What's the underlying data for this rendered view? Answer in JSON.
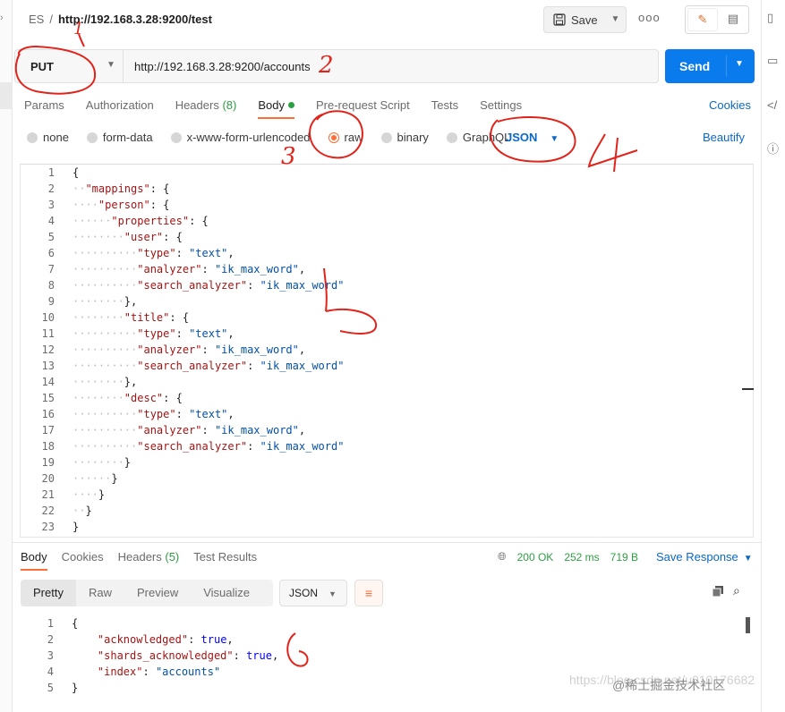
{
  "header": {
    "collection": "ES",
    "separator": "/",
    "request_name": "http://192.168.3.28:9200/test",
    "save_label": "Save",
    "more_label": "ooo"
  },
  "urlbar": {
    "method": "PUT",
    "url": "http://192.168.3.28:9200/accounts",
    "send_label": "Send"
  },
  "request_tabs": [
    {
      "label": "Params"
    },
    {
      "label": "Authorization"
    },
    {
      "label": "Headers",
      "count": "(8)"
    },
    {
      "label": "Body"
    },
    {
      "label": "Pre-request Script"
    },
    {
      "label": "Tests"
    },
    {
      "label": "Settings"
    }
  ],
  "cookies_label": "Cookies",
  "body_types": [
    "none",
    "form-data",
    "x-www-form-urlencoded",
    "raw",
    "binary",
    "GraphQL"
  ],
  "body_format": "JSON",
  "beautify_label": "Beautify",
  "request_body": [
    {
      "n": "1",
      "indent": "",
      "t": [
        [
          "p",
          "{"
        ]
      ]
    },
    {
      "n": "2",
      "indent": "··",
      "t": [
        [
          "k",
          "\"mappings\""
        ],
        [
          "p",
          ": {"
        ]
      ]
    },
    {
      "n": "3",
      "indent": "····",
      "t": [
        [
          "k",
          "\"person\""
        ],
        [
          "p",
          ": {"
        ]
      ]
    },
    {
      "n": "4",
      "indent": "······",
      "t": [
        [
          "k",
          "\"properties\""
        ],
        [
          "p",
          ": {"
        ]
      ]
    },
    {
      "n": "5",
      "indent": "········",
      "t": [
        [
          "k",
          "\"user\""
        ],
        [
          "p",
          ": {"
        ]
      ]
    },
    {
      "n": "6",
      "indent": "··········",
      "t": [
        [
          "k",
          "\"type\""
        ],
        [
          "p",
          ": "
        ],
        [
          "s",
          "\"text\""
        ],
        [
          "p",
          ","
        ]
      ]
    },
    {
      "n": "7",
      "indent": "··········",
      "t": [
        [
          "k",
          "\"analyzer\""
        ],
        [
          "p",
          ": "
        ],
        [
          "s",
          "\"ik_max_word\""
        ],
        [
          "p",
          ","
        ]
      ]
    },
    {
      "n": "8",
      "indent": "··········",
      "t": [
        [
          "k",
          "\"search_analyzer\""
        ],
        [
          "p",
          ": "
        ],
        [
          "s",
          "\"ik_max_word\""
        ]
      ]
    },
    {
      "n": "9",
      "indent": "········",
      "t": [
        [
          "p",
          "},"
        ]
      ]
    },
    {
      "n": "10",
      "indent": "········",
      "t": [
        [
          "k",
          "\"title\""
        ],
        [
          "p",
          ": {"
        ]
      ]
    },
    {
      "n": "11",
      "indent": "··········",
      "t": [
        [
          "k",
          "\"type\""
        ],
        [
          "p",
          ": "
        ],
        [
          "s",
          "\"text\""
        ],
        [
          "p",
          ","
        ]
      ]
    },
    {
      "n": "12",
      "indent": "··········",
      "t": [
        [
          "k",
          "\"analyzer\""
        ],
        [
          "p",
          ": "
        ],
        [
          "s",
          "\"ik_max_word\""
        ],
        [
          "p",
          ","
        ]
      ]
    },
    {
      "n": "13",
      "indent": "··········",
      "t": [
        [
          "k",
          "\"search_analyzer\""
        ],
        [
          "p",
          ": "
        ],
        [
          "s",
          "\"ik_max_word\""
        ]
      ]
    },
    {
      "n": "14",
      "indent": "········",
      "t": [
        [
          "p",
          "},"
        ]
      ]
    },
    {
      "n": "15",
      "indent": "········",
      "t": [
        [
          "k",
          "\"desc\""
        ],
        [
          "p",
          ": {"
        ]
      ]
    },
    {
      "n": "16",
      "indent": "··········",
      "t": [
        [
          "k",
          "\"type\""
        ],
        [
          "p",
          ": "
        ],
        [
          "s",
          "\"text\""
        ],
        [
          "p",
          ","
        ]
      ]
    },
    {
      "n": "17",
      "indent": "··········",
      "t": [
        [
          "k",
          "\"analyzer\""
        ],
        [
          "p",
          ": "
        ],
        [
          "s",
          "\"ik_max_word\""
        ],
        [
          "p",
          ","
        ]
      ]
    },
    {
      "n": "18",
      "indent": "··········",
      "t": [
        [
          "k",
          "\"search_analyzer\""
        ],
        [
          "p",
          ": "
        ],
        [
          "s",
          "\"ik_max_word\""
        ]
      ]
    },
    {
      "n": "19",
      "indent": "········",
      "t": [
        [
          "p",
          "}"
        ]
      ]
    },
    {
      "n": "20",
      "indent": "······",
      "t": [
        [
          "p",
          "}"
        ]
      ]
    },
    {
      "n": "21",
      "indent": "····",
      "t": [
        [
          "p",
          "}"
        ]
      ]
    },
    {
      "n": "22",
      "indent": "··",
      "t": [
        [
          "p",
          "}"
        ]
      ]
    },
    {
      "n": "23",
      "indent": "",
      "t": [
        [
          "p",
          "}"
        ]
      ]
    }
  ],
  "response": {
    "tabs": [
      {
        "label": "Body"
      },
      {
        "label": "Cookies"
      },
      {
        "label": "Headers",
        "count": "(5)"
      },
      {
        "label": "Test Results"
      }
    ],
    "status": "200 OK",
    "time": "252 ms",
    "size": "719 B",
    "save_label": "Save Response",
    "format_tabs": [
      "Pretty",
      "Raw",
      "Preview",
      "Visualize"
    ],
    "format": "JSON",
    "body": [
      {
        "n": "1",
        "indent": "",
        "t": [
          [
            "p",
            "{"
          ]
        ]
      },
      {
        "n": "2",
        "indent": "    ",
        "t": [
          [
            "k",
            "\"acknowledged\""
          ],
          [
            "p",
            ": "
          ],
          [
            "b",
            "true"
          ],
          [
            "p",
            ","
          ]
        ]
      },
      {
        "n": "3",
        "indent": "    ",
        "t": [
          [
            "k",
            "\"shards_acknowledged\""
          ],
          [
            "p",
            ": "
          ],
          [
            "b",
            "true"
          ],
          [
            "p",
            ","
          ]
        ]
      },
      {
        "n": "4",
        "indent": "    ",
        "t": [
          [
            "k",
            "\"index\""
          ],
          [
            "p",
            ": "
          ],
          [
            "s",
            "\"accounts\""
          ]
        ]
      },
      {
        "n": "5",
        "indent": "",
        "t": [
          [
            "p",
            "}"
          ]
        ]
      }
    ]
  },
  "watermark": "https://blog.csdn.net/u010176682",
  "watermark_brand": "@稀土掘金技术社区",
  "annotations": [
    "1",
    "2",
    "3",
    "4",
    "5",
    "6"
  ],
  "colors": {
    "accent": "#ff6c37",
    "link": "#0b67c8",
    "send": "#097bed",
    "ok": "#2d9f43",
    "annotation": "#e2231a"
  }
}
